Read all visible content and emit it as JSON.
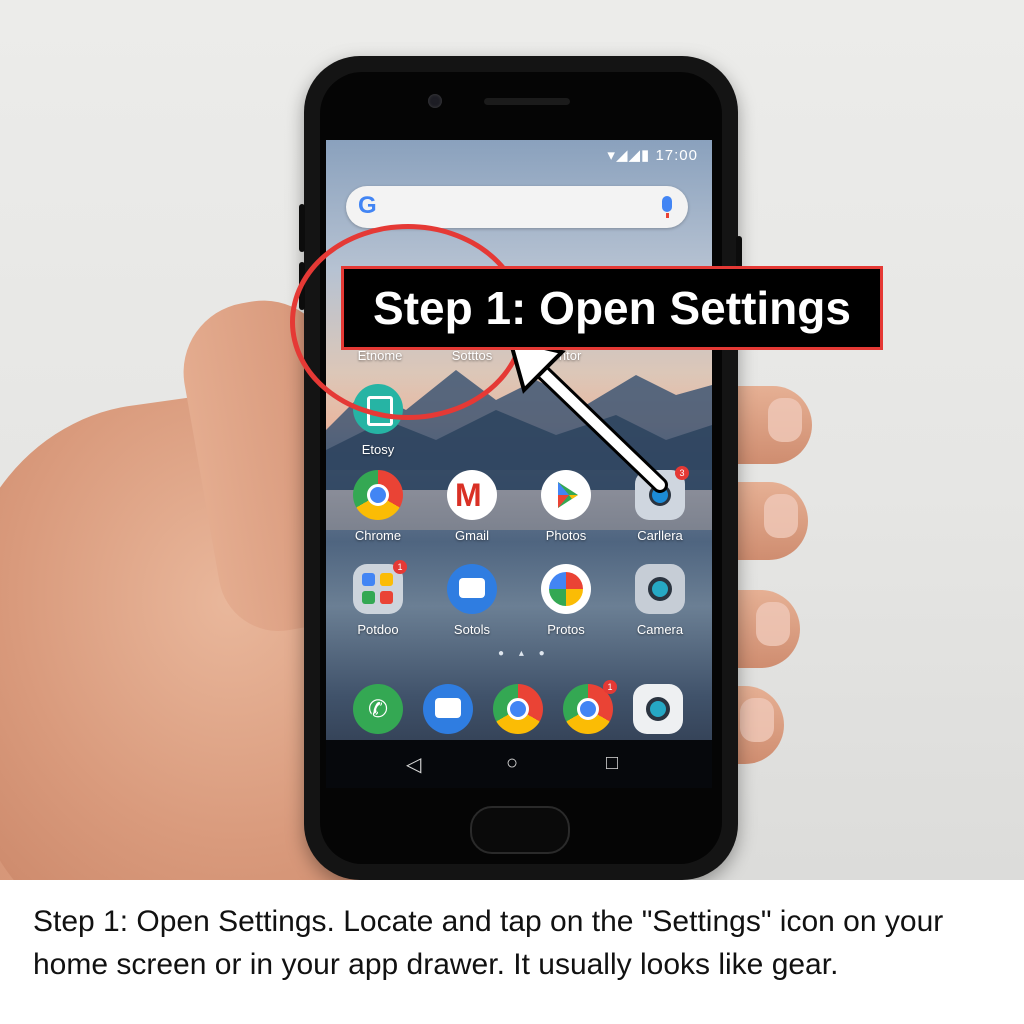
{
  "status_bar": {
    "time": "17:00",
    "signal_glyphs": "▾◢◢▮"
  },
  "search_bar": {
    "logo": "G"
  },
  "apps_row1": [
    {
      "label": "Etnome",
      "icon": "phone-app-icon"
    },
    {
      "label": "Sotttos",
      "icon": "settings-app-icon"
    },
    {
      "label": "Frhtor",
      "icon": "photos-app-icon"
    }
  ],
  "apps_row2": [
    {
      "label": "Etosy",
      "icon": "store-app-icon"
    }
  ],
  "apps_row3": [
    {
      "label": "Chrome",
      "icon": "chrome-icon"
    },
    {
      "label": "Gmail",
      "icon": "gmail-icon"
    },
    {
      "label": "Photos",
      "icon": "play-store-icon"
    },
    {
      "label": "Carllera",
      "icon": "camera-icon",
      "badge": "3"
    }
  ],
  "apps_row4": [
    {
      "label": "Potdoo",
      "icon": "folder-icon",
      "badge": "1"
    },
    {
      "label": "Sotols",
      "icon": "messages-icon"
    },
    {
      "label": "Protos",
      "icon": "photos-pinwheel-icon"
    },
    {
      "label": "Camera",
      "icon": "camera-icon"
    }
  ],
  "dock": [
    {
      "icon": "phone-icon"
    },
    {
      "icon": "messages-icon"
    },
    {
      "icon": "chrome-icon"
    },
    {
      "icon": "chrome-icon",
      "badge": "1"
    },
    {
      "icon": "camera-icon"
    }
  ],
  "nav_buttons": {
    "back": "◁",
    "home": "○",
    "recents": "□"
  },
  "overlay": {
    "banner": "Step 1: Open Settings"
  },
  "caption": "Step 1: Open Settings. Locate and tap on the \"Settings\" icon on your home screen or in your app drawer. It usually looks like gear."
}
